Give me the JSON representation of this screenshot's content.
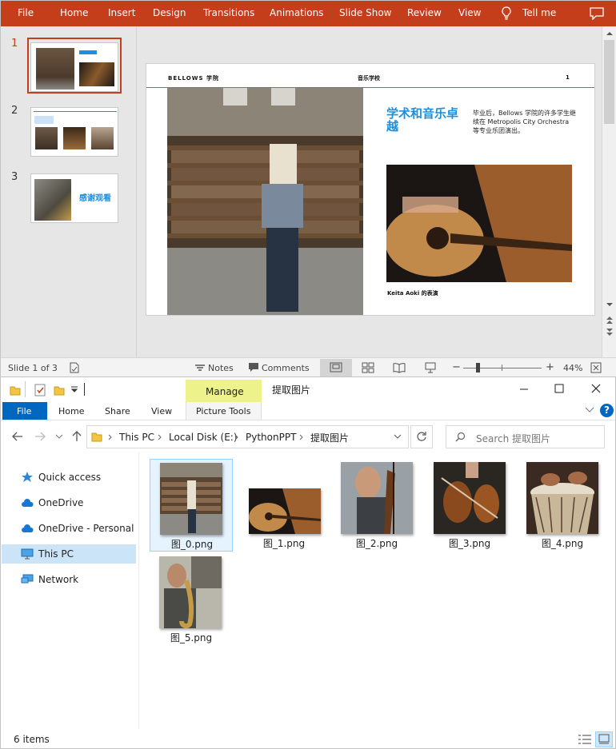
{
  "ppt": {
    "menu": [
      "File",
      "Home",
      "Insert",
      "Design",
      "Transitions",
      "Animations",
      "Slide Show",
      "Review",
      "View",
      "Tell me"
    ],
    "thumb_numbers": [
      "1",
      "2",
      "3"
    ],
    "thumb3_text": "感谢观看",
    "slide": {
      "brand": "BELLOWS 学院",
      "center": "音乐学校",
      "page_number": "1",
      "title": "学术和音乐卓越",
      "body": "毕业后，Bellows 学院的许多学生继续在 Metropolis City Orchestra 等专业乐团演出。",
      "caption": "Keita Aoki 的表演"
    },
    "status": {
      "slide_of": "Slide 1 of 3",
      "notes": "Notes",
      "comments": "Comments",
      "zoom_minus": "−",
      "zoom_plus": "+",
      "zoom": "44%"
    }
  },
  "explorer": {
    "title": "提取图片",
    "manage_tab": "Manage",
    "ribbon_tabs": [
      "File",
      "Home",
      "Share",
      "View"
    ],
    "picture_tools": "Picture Tools",
    "breadcrumb": [
      "This PC",
      "Local Disk (E:)",
      "PythonPPT",
      "提取图片"
    ],
    "search_placeholder": "Search 提取图片",
    "nav_items": [
      "Quick access",
      "OneDrive",
      "OneDrive - Personal",
      "This PC",
      "Network"
    ],
    "files": [
      "图_0.png",
      "图_1.png",
      "图_2.png",
      "图_3.png",
      "图_4.png",
      "图_5.png"
    ],
    "item_count": "6 items",
    "help": "?"
  },
  "colors": {
    "ppt_accent": "#c43e1c",
    "explorer_accent": "#0067c0",
    "slide_title": "#1b8fe0",
    "manage_tab": "#eef28a"
  }
}
